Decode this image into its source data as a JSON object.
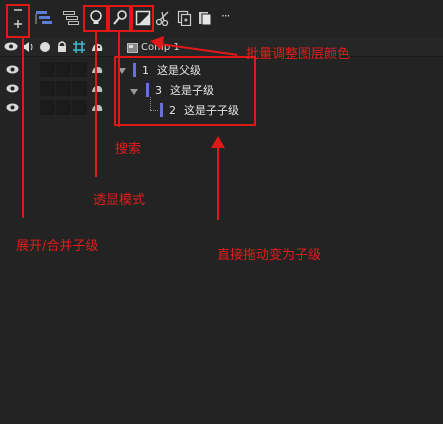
{
  "toolbar": {
    "more_label": "···",
    "buttons": [
      {
        "icon": "expand-collapse-icon"
      },
      {
        "icon": "layer-stack-blue-icon"
      },
      {
        "icon": "layer-stack-outline-icon"
      },
      {
        "icon": "bulb-icon"
      },
      {
        "icon": "search-icon"
      },
      {
        "icon": "color-swatch-icon"
      },
      {
        "icon": "scissors-icon"
      },
      {
        "icon": "duplicate-icon"
      },
      {
        "icon": "paste-icon"
      }
    ]
  },
  "comp": {
    "name": "Comp 1"
  },
  "layers": [
    {
      "index": "1",
      "name": "这是父级"
    },
    {
      "index": "3",
      "name": "这是子级"
    },
    {
      "index": "2",
      "name": "这是子子级"
    }
  ],
  "annotations": {
    "batch_color": "批量调整图层颜色",
    "search": "搜索",
    "transparent_mode": "透显模式",
    "expand_collapse": "展开/合并子级",
    "drag_to_child": "直接拖动变为子级"
  },
  "colors": {
    "background": "#232323",
    "annotation_red": "#e01818",
    "layer_label": "#6b6fd8"
  }
}
